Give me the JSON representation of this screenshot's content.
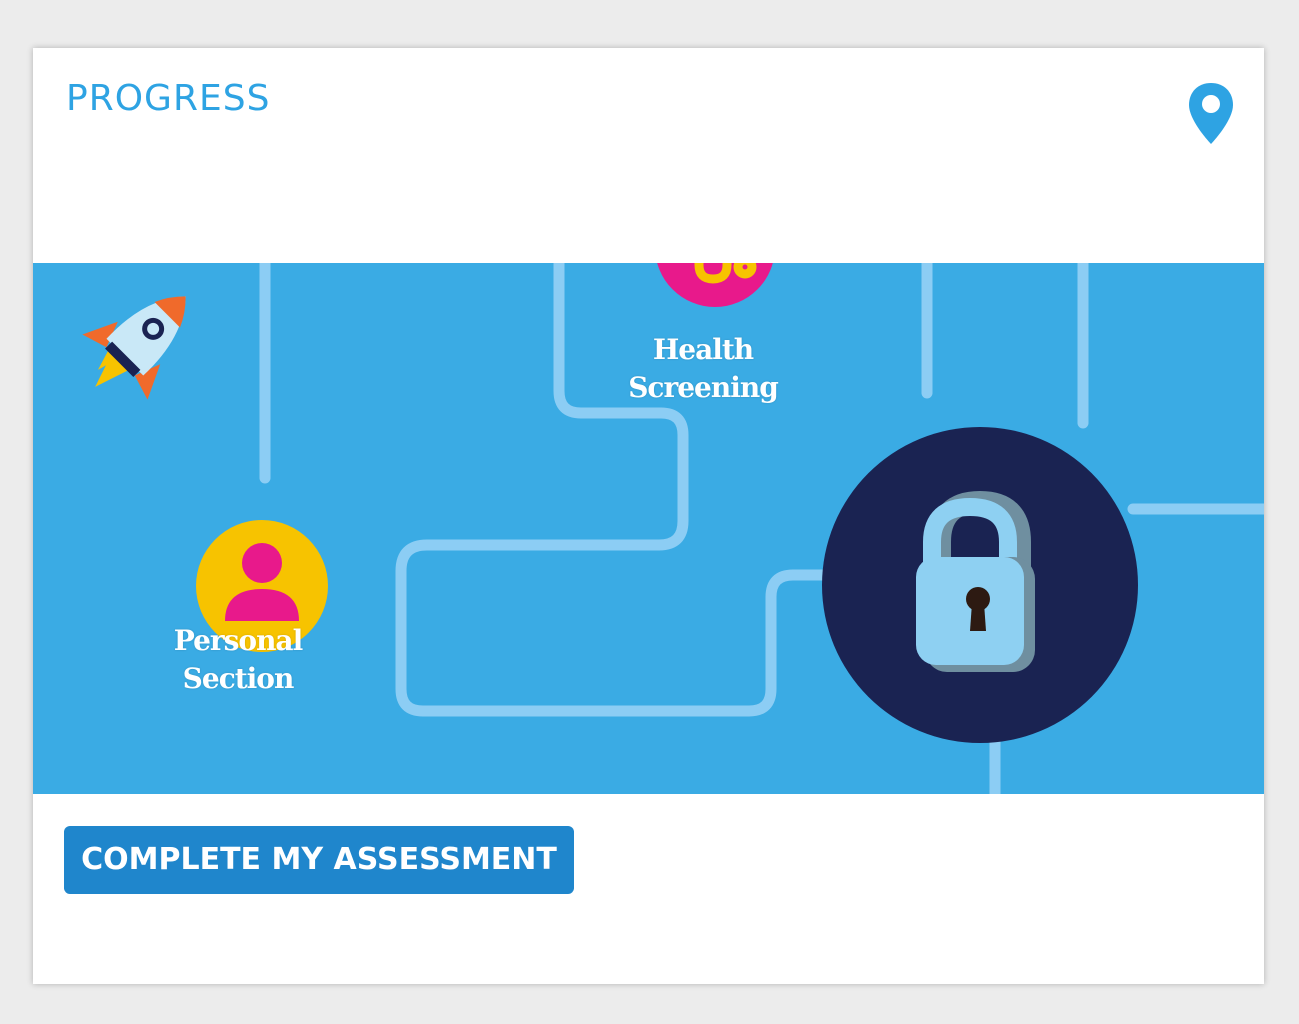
{
  "card": {
    "title": "PROGRESS",
    "location_icon": "map-pin-icon"
  },
  "journey": {
    "nodes": [
      {
        "id": "health",
        "label_line1": "Health",
        "label_line2": "Screening",
        "icon": "stethoscope-icon",
        "color": "#e8198b"
      },
      {
        "id": "personal",
        "label_line1": "Personal",
        "label_line2": "Section",
        "icon": "person-icon",
        "color": "#f7c300"
      },
      {
        "id": "locked",
        "icon": "padlock-icon",
        "color": "#1a2352"
      }
    ],
    "decoration": "rocket-icon"
  },
  "actions": {
    "complete_label": "COMPLETE MY ASSESSMENT"
  },
  "colors": {
    "accent": "#2ea3e3",
    "banner": "#3aabe4",
    "button": "#1f86cc",
    "path": "#8ccdf4"
  }
}
